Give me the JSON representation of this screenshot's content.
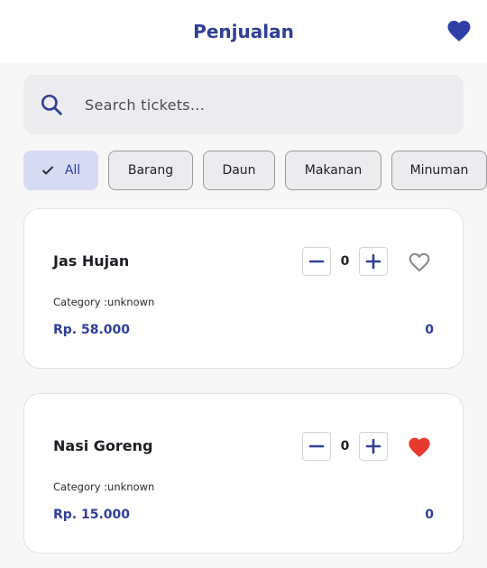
{
  "header": {
    "title": "Penjualan",
    "favorite_icon_color": "#2f3fa8"
  },
  "search": {
    "placeholder": "Search tickets..."
  },
  "filters": [
    {
      "label": "All",
      "active": true
    },
    {
      "label": "Barang",
      "active": false
    },
    {
      "label": "Daun",
      "active": false
    },
    {
      "label": "Makanan",
      "active": false
    },
    {
      "label": "Minuman",
      "active": false
    }
  ],
  "products": [
    {
      "name": "Jas Hujan",
      "category": "Category :unknown",
      "price": "Rp. 58.000",
      "quantity": "0",
      "total": "0",
      "favorite": false
    },
    {
      "name": "Nasi Goreng",
      "category": "Category :unknown",
      "price": "Rp. 15.000",
      "quantity": "0",
      "total": "0",
      "favorite": true
    }
  ],
  "colors": {
    "accent": "#2f3f97",
    "favorite_active": "#e8392f",
    "favorite_inactive": "#8a8a90"
  }
}
